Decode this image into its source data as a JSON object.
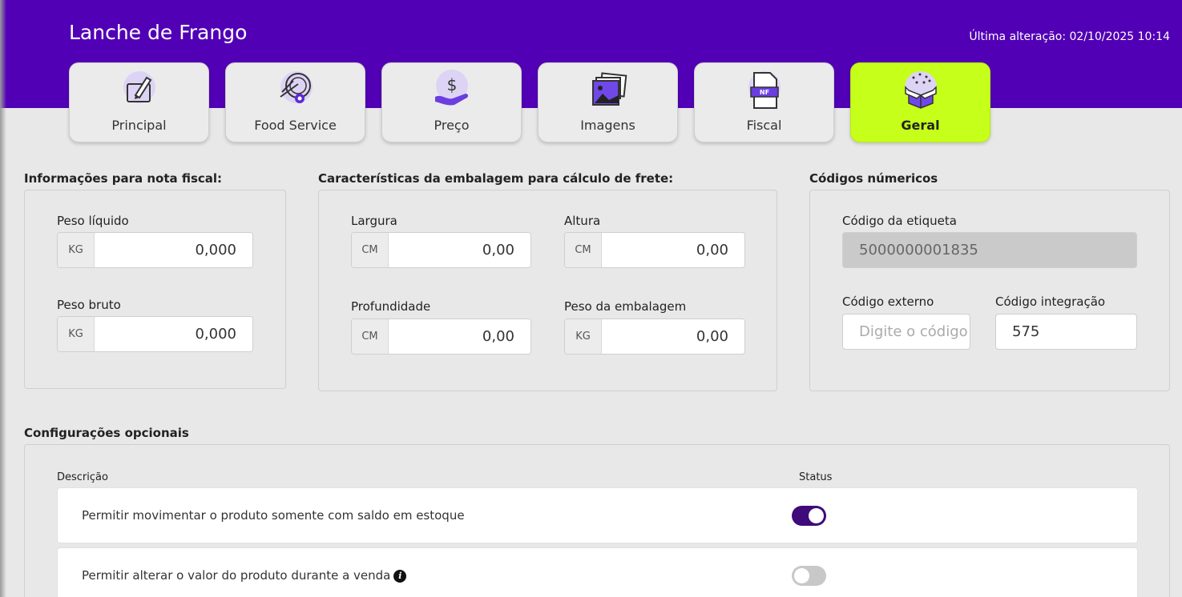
{
  "header": {
    "title": "Lanche de Frango",
    "last_change": "Última alteração: 02/10/2025 10:14"
  },
  "tabs": [
    {
      "label": "Principal",
      "icon": "edit-document-icon",
      "active": false
    },
    {
      "label": "Food Service",
      "icon": "food-service-icon",
      "active": false
    },
    {
      "label": "Preço",
      "icon": "price-hand-icon",
      "active": false
    },
    {
      "label": "Imagens",
      "icon": "images-icon",
      "active": false
    },
    {
      "label": "Fiscal",
      "icon": "nf-document-icon",
      "active": false
    },
    {
      "label": "Geral",
      "icon": "gift-box-icon",
      "active": true
    }
  ],
  "nota_fiscal": {
    "title": "Informações para nota fiscal:",
    "peso_liquido": {
      "label": "Peso líquido",
      "unit": "KG",
      "value": "0,000"
    },
    "peso_bruto": {
      "label": "Peso bruto",
      "unit": "KG",
      "value": "0,000"
    }
  },
  "embalagem": {
    "title": "Características da embalagem para cálculo de frete:",
    "largura": {
      "label": "Largura",
      "unit": "CM",
      "value": "0,00"
    },
    "altura": {
      "label": "Altura",
      "unit": "CM",
      "value": "0,00"
    },
    "profundidade": {
      "label": "Profundidade",
      "unit": "CM",
      "value": "0,00"
    },
    "peso_embalagem": {
      "label": "Peso da embalagem",
      "unit": "KG",
      "value": "0,00"
    }
  },
  "codigos": {
    "title": "Códigos númericos",
    "etiqueta": {
      "label": "Código da etiqueta",
      "value": "5000000001835"
    },
    "externo": {
      "label": "Código externo",
      "placeholder": "Digite o código",
      "value": ""
    },
    "integracao": {
      "label": "Código integração",
      "value": "575"
    }
  },
  "opcionais": {
    "title": "Configurações opcionais",
    "col_descricao": "Descrição",
    "col_status": "Status",
    "rows": [
      {
        "text": "Permitir movimentar o produto somente com saldo em estoque",
        "status": true,
        "info": false
      },
      {
        "text": "Permitir alterar o valor do produto durante a venda",
        "status": false,
        "info": true
      }
    ]
  },
  "colors": {
    "header": "#5200b5",
    "active_tab": "#c5ff1a",
    "toggle_on": "#3f0a7a",
    "toggle_off": "#c8c8c8"
  }
}
